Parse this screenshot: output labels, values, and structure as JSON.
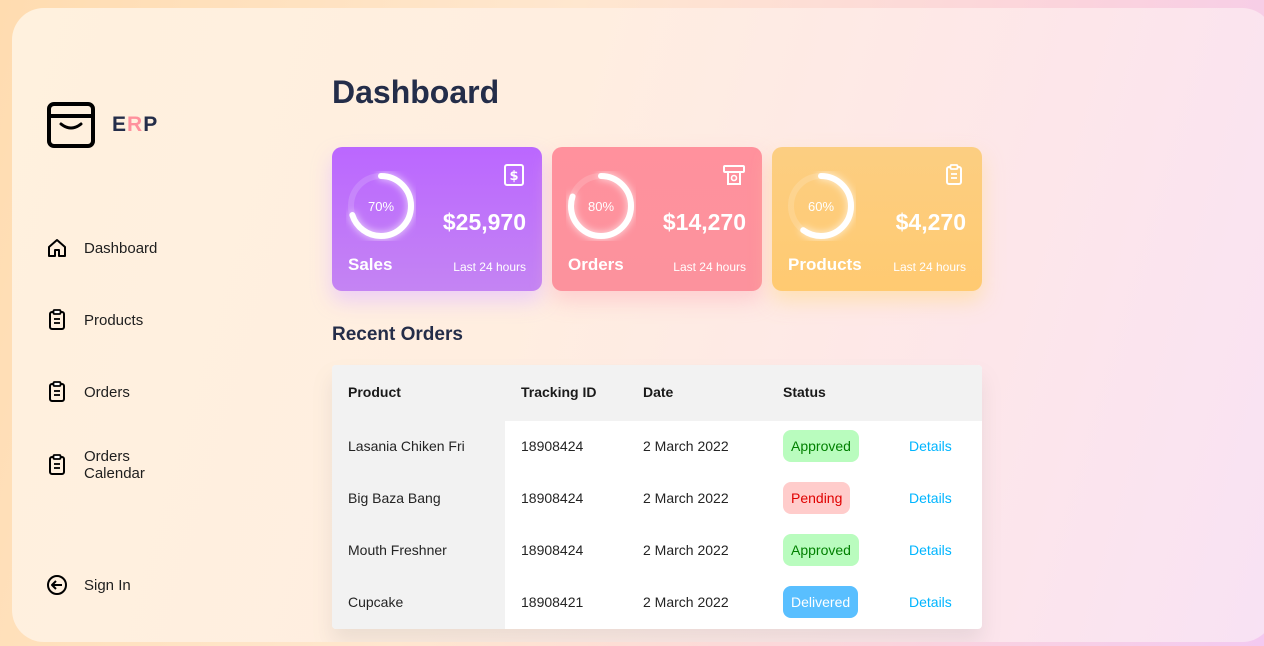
{
  "brand": {
    "logo_icon": "shopping-bag-icon",
    "name_part1": "E",
    "name_part2": "R",
    "name_part3": "P",
    "accent": "#ff919d"
  },
  "sidebar": {
    "items": [
      {
        "label": "Dashboard",
        "icon": "home-icon"
      },
      {
        "label": "Products",
        "icon": "clipboard-icon"
      },
      {
        "label": "Orders",
        "icon": "clipboard-icon"
      },
      {
        "label": "Orders Calendar",
        "icon": "clipboard-icon"
      }
    ],
    "signin": {
      "label": "Sign In",
      "icon": "sign-in-arrow-icon"
    }
  },
  "main": {
    "title": "Dashboard",
    "cards": [
      {
        "name": "Sales",
        "percent_label": "70%",
        "percent": 70,
        "amount": "$25,970",
        "subtitle": "Last 24 hours",
        "icon": "dollar-icon",
        "color": "#bb67ff"
      },
      {
        "name": "Orders",
        "percent_label": "80%",
        "percent": 80,
        "amount": "$14,270",
        "subtitle": "Last 24 hours",
        "icon": "money-icon",
        "color": "#ff919d"
      },
      {
        "name": "Products",
        "percent_label": "60%",
        "percent": 60,
        "amount": "$4,270",
        "subtitle": "Last 24 hours",
        "icon": "clipboard-icon",
        "color": "#ffca71"
      }
    ],
    "recent_orders": {
      "title": "Recent Orders",
      "columns": [
        "Product",
        "Tracking ID",
        "Date",
        "Status"
      ],
      "rows": [
        {
          "product": "Lasania Chiken Fri",
          "tracking": "18908424",
          "date": "2 March 2022",
          "status": "Approved",
          "action": "Details"
        },
        {
          "product": "Big Baza Bang",
          "tracking": "18908424",
          "date": "2 March 2022",
          "status": "Pending",
          "action": "Details"
        },
        {
          "product": "Mouth Freshner",
          "tracking": "18908424",
          "date": "2 March 2022",
          "status": "Approved",
          "action": "Details"
        },
        {
          "product": "Cupcake",
          "tracking": "18908421",
          "date": "2 March 2022",
          "status": "Delivered",
          "action": "Details"
        }
      ]
    }
  }
}
